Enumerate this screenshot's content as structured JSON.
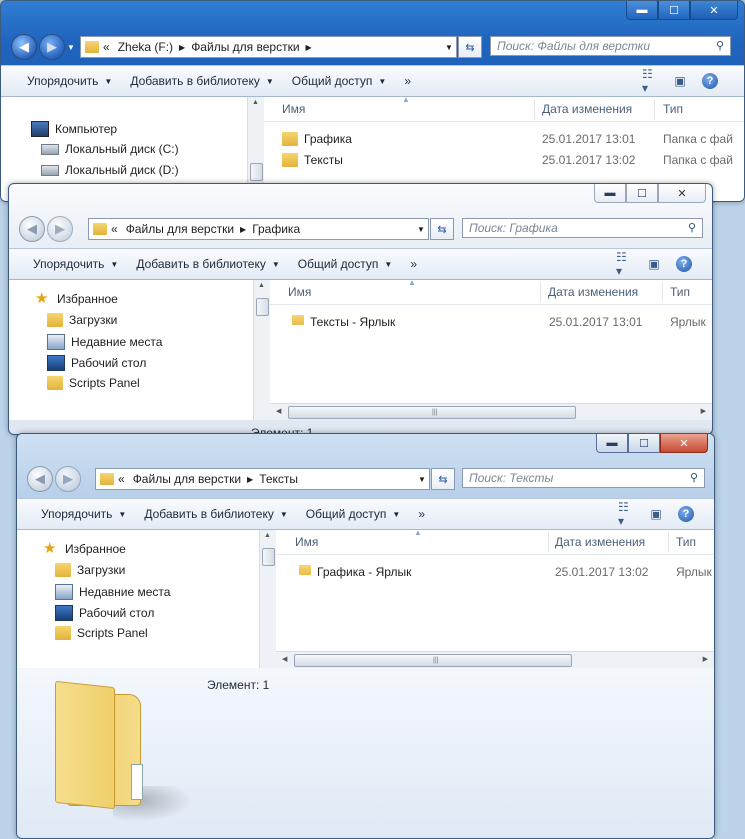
{
  "toolbar": {
    "organize": "Упорядочить",
    "add_library": "Добавить в библиотеку",
    "share": "Общий доступ",
    "more": "»"
  },
  "columns": {
    "name": "Имя",
    "date": "Дата изменения",
    "type": "Тип"
  },
  "window1": {
    "breadcrumb": [
      "«",
      "Zheka (F:)",
      "Файлы для верстки"
    ],
    "search_placeholder": "Поиск: Файлы для верстки",
    "nav": [
      "Компьютер",
      "Локальный диск (C:)",
      "Локальный диск (D:)"
    ],
    "files": [
      {
        "name": "Графика",
        "date": "25.01.2017 13:01",
        "type": "Папка с фай"
      },
      {
        "name": "Тексты",
        "date": "25.01.2017 13:02",
        "type": "Папка с фай"
      }
    ]
  },
  "window2": {
    "breadcrumb": [
      "«",
      "Файлы для верстки",
      "Графика"
    ],
    "search_placeholder": "Поиск: Графика",
    "nav": [
      "Избранное",
      "Загрузки",
      "Недавние места",
      "Рабочий стол",
      "Scripts Panel"
    ],
    "files": [
      {
        "name": "Тексты - Ярлык",
        "date": "25.01.2017 13:01",
        "type": "Ярлык"
      }
    ],
    "status": "Элемент: 1"
  },
  "window3": {
    "breadcrumb": [
      "«",
      "Файлы для верстки",
      "Тексты"
    ],
    "search_placeholder": "Поиск: Тексты",
    "nav": [
      "Избранное",
      "Загрузки",
      "Недавние места",
      "Рабочий стол",
      "Scripts Panel"
    ],
    "files": [
      {
        "name": "Графика - Ярлык",
        "date": "25.01.2017 13:02",
        "type": "Ярлык"
      }
    ],
    "status": "Элемент: 1"
  },
  "icons": {
    "back": "back-arrow-icon",
    "forward": "forward-arrow-icon",
    "refresh": "refresh-icon",
    "search": "search-icon",
    "views": "views-icon",
    "preview_pane": "preview-pane-icon",
    "help": "help-icon"
  }
}
